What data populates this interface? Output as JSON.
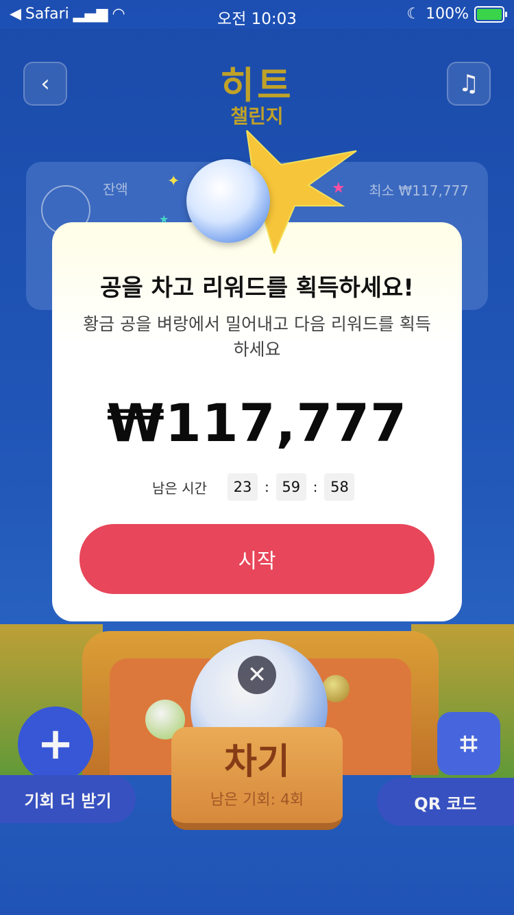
{
  "status_bar": {
    "back_app": "Safari",
    "time": "오전 10:03",
    "battery": "100%"
  },
  "header": {
    "logo_main": "히트",
    "logo_sub": "챌린지"
  },
  "balance_card": {
    "label": "잔액",
    "min_label": "최소  ₩117,777"
  },
  "modal": {
    "title": "공을 차고 리워드를 획득하세요!",
    "description": "황금 공을 벼랑에서 밀어내고 다음 리워드를 획득하세요",
    "amount": "₩117,777",
    "timer_label": "남은 시간",
    "timer": {
      "hours": "23",
      "minutes": "59",
      "seconds": "58"
    },
    "start_label": "시작"
  },
  "game": {
    "kick_label": "차기",
    "remaining_label": "남은 기회: 4회",
    "more_chances_label": "기회 더 받기",
    "qr_label": "QR 코드"
  },
  "colors": {
    "accent": "#e8465a",
    "background": "#2259be",
    "logo": "#c8a92a"
  }
}
